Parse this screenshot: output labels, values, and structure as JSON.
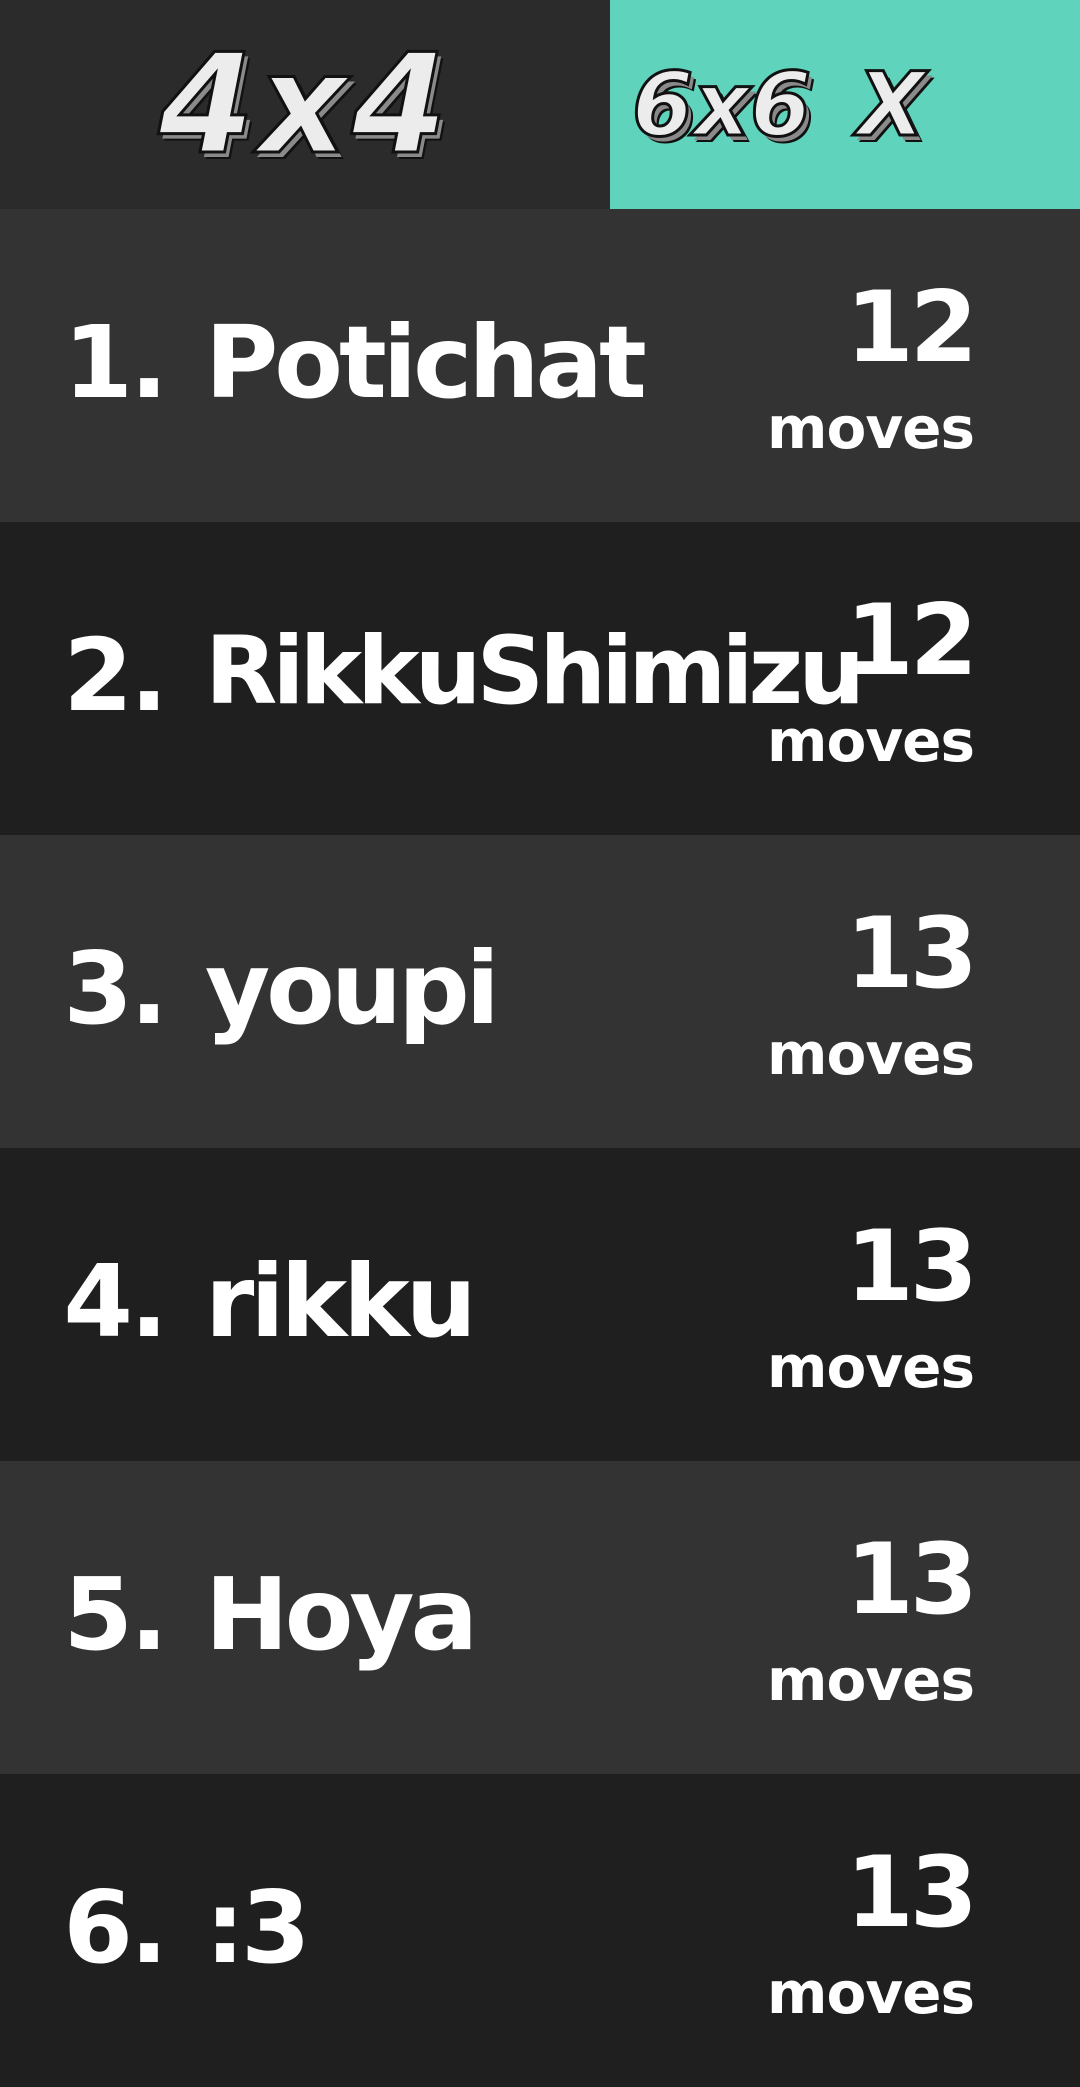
{
  "tabs": {
    "four_by_four": "4x4",
    "six_by_six": "6x6",
    "close": "X"
  },
  "colors": {
    "active_tab": "#5fd3bc",
    "inactive_tab": "#2b2b2b",
    "row_light": "#333333",
    "row_dark": "#1f1f1f",
    "text": "#ffffff"
  },
  "leaderboard": [
    {
      "rank": "1.",
      "name": "Potichat",
      "score": "12",
      "unit": "moves"
    },
    {
      "rank": "2.",
      "name": "RikkuShimizu",
      "score": "12",
      "unit": "moves"
    },
    {
      "rank": "3.",
      "name": "youpi",
      "score": "13",
      "unit": "moves"
    },
    {
      "rank": "4.",
      "name": "rikku",
      "score": "13",
      "unit": "moves"
    },
    {
      "rank": "5.",
      "name": "Hoya",
      "score": "13",
      "unit": "moves"
    },
    {
      "rank": "6.",
      "name": ":3",
      "score": "13",
      "unit": "moves"
    }
  ]
}
